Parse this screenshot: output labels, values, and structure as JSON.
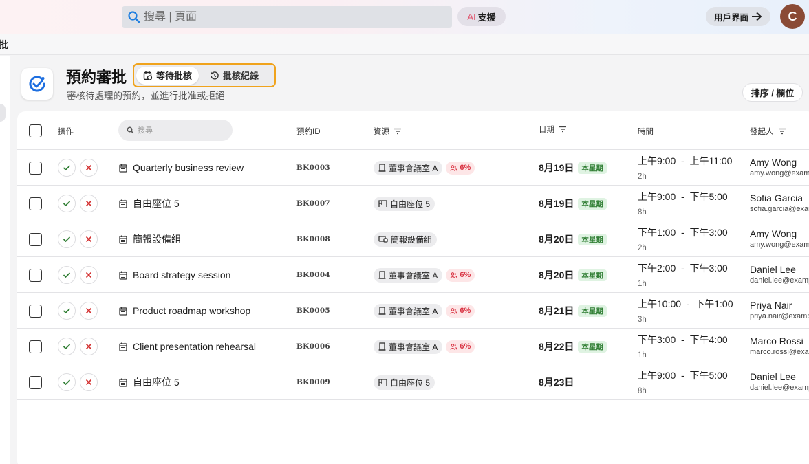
{
  "topbar": {
    "search_placeholder": "搜尋 | 頁面",
    "ai_label_prefix": "AI",
    "ai_label": "支援",
    "user_view_label": "用戶界面",
    "avatar_initial": "C"
  },
  "breadcrumb_fragment": "批",
  "header": {
    "title": "預約審批",
    "subtitle": "審核待處理的預約，並進行批准或拒絕",
    "tabs": [
      {
        "label": "等待批核",
        "active": true
      },
      {
        "label": "批核紀錄",
        "active": false
      }
    ],
    "sort_label": "排序 / 欄位"
  },
  "table": {
    "columns": {
      "actions": "操作",
      "search_placeholder": "搜尋",
      "booking_id": "預約ID",
      "resource": "資源",
      "date": "日期",
      "time": "時間",
      "requester": "發起人"
    },
    "rows": [
      {
        "title": "Quarterly business review",
        "id": "BK0003",
        "resource": "董事會議室 A",
        "resource_icon": "door-icon",
        "occupancy": "6%",
        "date": "8月19日",
        "week_badge": "本星期",
        "time": "上午9:00  -  上午11:00",
        "duration": "2h",
        "name": "Amy Wong",
        "email": "amy.wong@example.com"
      },
      {
        "title": "自由座位 5",
        "id": "BK0007",
        "resource": "自由座位 5",
        "resource_icon": "desk-icon",
        "occupancy": "",
        "date": "8月19日",
        "week_badge": "本星期",
        "time": "上午9:00  -  下午5:00",
        "duration": "8h",
        "name": "Sofia Garcia",
        "email": "sofia.garcia@example.com"
      },
      {
        "title": "簡報設備組",
        "id": "BK0008",
        "resource": "簡報設備組",
        "resource_icon": "projector-icon",
        "occupancy": "",
        "date": "8月20日",
        "week_badge": "本星期",
        "time": "下午1:00  -  下午3:00",
        "duration": "2h",
        "name": "Amy Wong",
        "email": "amy.wong@example.com"
      },
      {
        "title": "Board strategy session",
        "id": "BK0004",
        "resource": "董事會議室 A",
        "resource_icon": "door-icon",
        "occupancy": "6%",
        "date": "8月20日",
        "week_badge": "本星期",
        "time": "下午2:00  -  下午3:00",
        "duration": "1h",
        "name": "Daniel Lee",
        "email": "daniel.lee@example.com"
      },
      {
        "title": "Product roadmap workshop",
        "id": "BK0005",
        "resource": "董事會議室 A",
        "resource_icon": "door-icon",
        "occupancy": "6%",
        "date": "8月21日",
        "week_badge": "本星期",
        "time": "上午10:00  -  下午1:00",
        "duration": "3h",
        "name": "Priya Nair",
        "email": "priya.nair@example.com"
      },
      {
        "title": "Client presentation rehearsal",
        "id": "BK0006",
        "resource": "董事會議室 A",
        "resource_icon": "door-icon",
        "occupancy": "6%",
        "date": "8月22日",
        "week_badge": "本星期",
        "time": "下午3:00  -  下午4:00",
        "duration": "1h",
        "name": "Marco Rossi",
        "email": "marco.rossi@example.com"
      },
      {
        "title": "自由座位 5",
        "id": "BK0009",
        "resource": "自由座位 5",
        "resource_icon": "desk-icon",
        "occupancy": "",
        "date": "8月23日",
        "week_badge": "",
        "time": "上午9:00  -  下午5:00",
        "duration": "8h",
        "name": "Daniel Lee",
        "email": "daniel.lee@example.com"
      }
    ]
  },
  "colors": {
    "accent_orange": "#f0a31c",
    "approve_green": "#2e7d32",
    "reject_red": "#d32f2f",
    "brand_blue": "#1e6fe0"
  }
}
